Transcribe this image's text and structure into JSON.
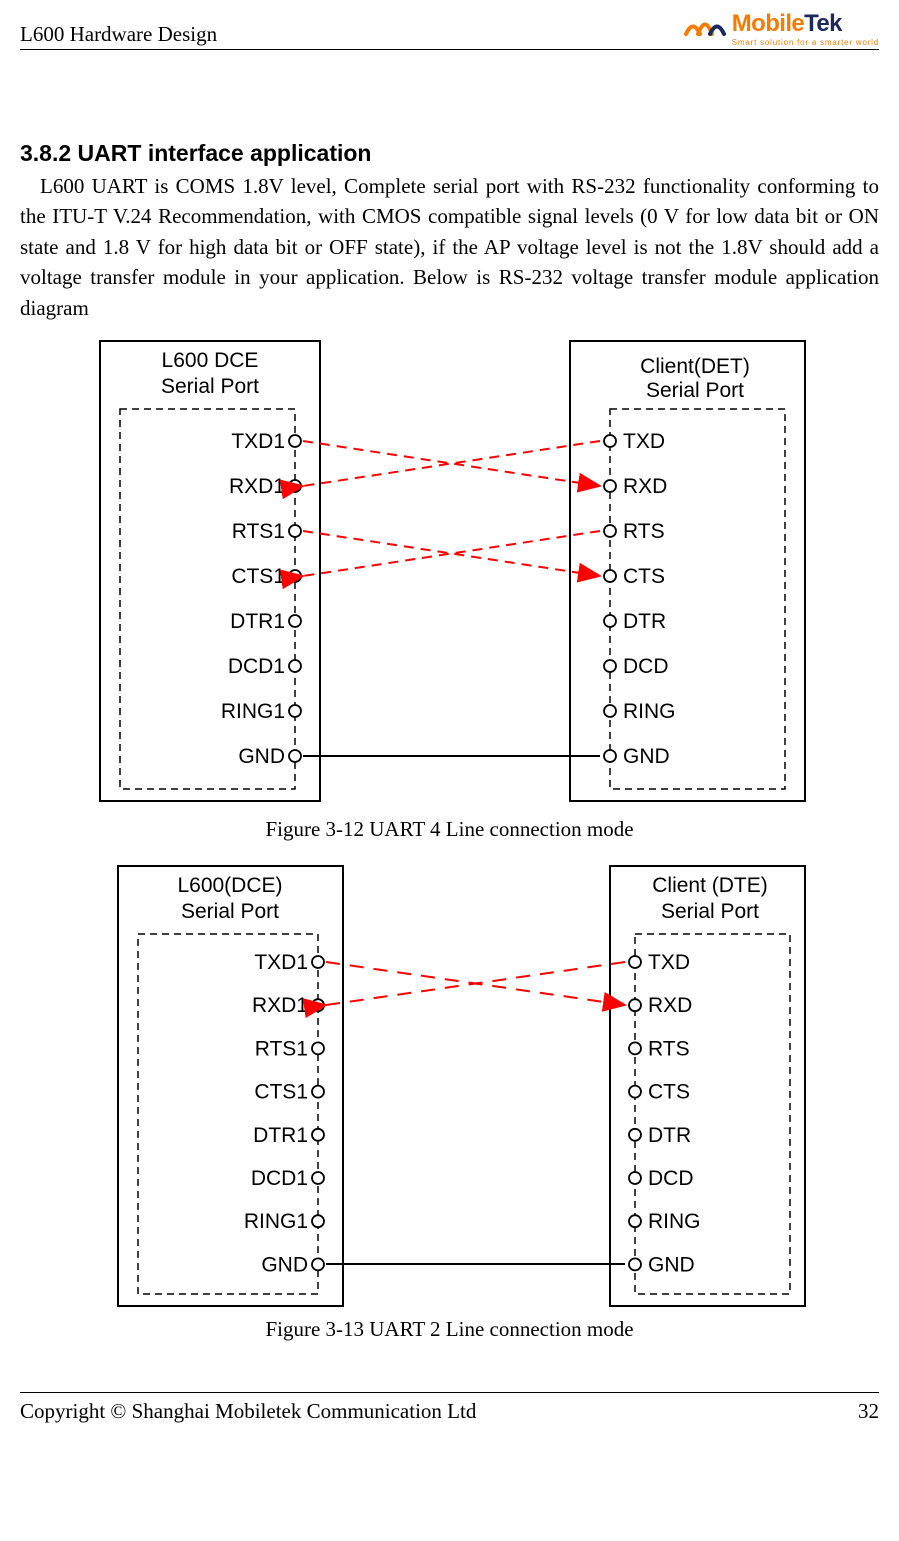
{
  "header": {
    "title": "L600 Hardware Design",
    "logo_main_1": "Mobile",
    "logo_main_2": "Tek",
    "logo_tagline": "Smart solution for a smarter world"
  },
  "section": {
    "heading": "3.8.2 UART interface application",
    "paragraph": "L600 UART is COMS 1.8V level, Complete serial port with RS-232 functionality conforming to the ITU-T V.24 Recommendation, with CMOS compatible signal levels (0 V for low data bit or ON state and 1.8 V for high data bit or OFF state), if the AP voltage level is not the 1.8V should add a voltage transfer module in your application. Below is RS-232 voltage transfer module application diagram"
  },
  "diagram1": {
    "left_title1": "L600 DCE",
    "left_title2": "Serial Port",
    "right_title1": "Client(DET)",
    "right_title2": "Serial Port",
    "left_pins": [
      "TXD1",
      "RXD1",
      "RTS1",
      "CTS1",
      "DTR1",
      "DCD1",
      "RING1",
      "GND"
    ],
    "right_pins": [
      "TXD",
      "RXD",
      "RTS",
      "CTS",
      "DTR",
      "DCD",
      "RING",
      "GND"
    ],
    "caption": "Figure 3-12 UART 4 Line connection mode"
  },
  "diagram2": {
    "left_title1": "L600(DCE)",
    "left_title2": "Serial Port",
    "right_title1": "Client (DTE)",
    "right_title2": "Serial Port",
    "left_pins": [
      "TXD1",
      "RXD1",
      "RTS1",
      "CTS1",
      "DTR1",
      "DCD1",
      "RING1",
      "GND"
    ],
    "right_pins": [
      "TXD",
      "RXD",
      "RTS",
      "CTS",
      "DTR",
      "DCD",
      "RING",
      "GND"
    ],
    "caption": "Figure 3-13 UART 2 Line connection mode"
  },
  "footer": {
    "copyright": "Copyright © Shanghai Mobiletek Communication Ltd",
    "page_number": "32"
  }
}
